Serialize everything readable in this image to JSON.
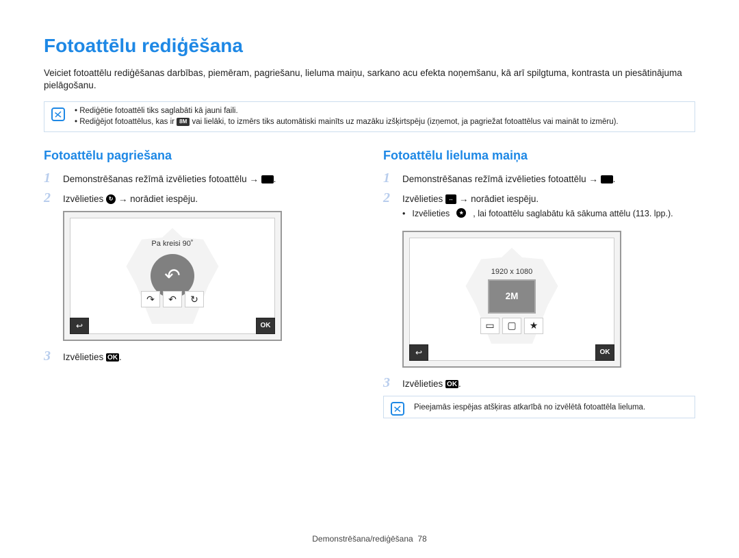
{
  "title": "Fotoattēlu rediģēšana",
  "intro": "Veiciet fotoattēlu rediģēšanas darbības, piemēram, pagriešanu, lieluma maiņu, sarkano acu efekta noņemšanu, kā arī spilgtuma, kontrasta un piesātinājuma pielāgošanu.",
  "info_top": {
    "items": [
      "Rediģētie fotoattēli tiks saglabāti kā jauni faili.",
      "Rediģējot fotoattēlus, kas ir"
    ],
    "item2_cont_mid": "vai lielāki, to izmērs tiks automātiski mainīts uz mazāku izšķirtspēju (izņemot, ja pagriežat fotoattēlus vai maināt to izmēru).",
    "badge_8m": "8M"
  },
  "left": {
    "heading": "Fotoattēlu pagriešana",
    "step1_a": "Demonstrēšanas režīmā izvēlieties fotoattēlu →",
    "step1_b": ".",
    "step2_a": "Izvēlieties",
    "step2_b": "→ norādiet iespēju.",
    "shot_label": "Pa kreisi 90˚",
    "step3_a": "Izvēlieties",
    "step3_b": "."
  },
  "right": {
    "heading": "Fotoattēlu lieluma maiņa",
    "step1_a": "Demonstrēšanas režīmā izvēlieties fotoattēlu →",
    "step1_b": ".",
    "step2_a": "Izvēlieties",
    "step2_b": "→ norādiet iespēju.",
    "bullet_a": "Izvēlieties",
    "bullet_b": ", lai fotoattēlu saglabātu kā sākuma attēlu (113. lpp.).",
    "shot_label": "1920 x 1080",
    "shot_badge": "2M",
    "step3_a": "Izvēlieties",
    "step3_b": ".",
    "note": "Pieejamās iespējas atšķiras atkarībā no izvēlētā fotoattēla lieluma."
  },
  "ok_label": "OK",
  "footer": {
    "section": "Demonstrēšana/rediģēšana",
    "page": "78"
  }
}
